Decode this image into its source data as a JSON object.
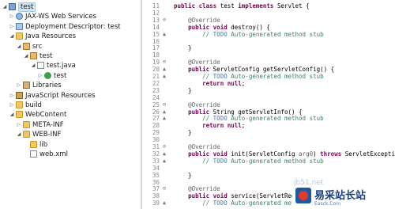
{
  "explorer": {
    "items": [
      {
        "label": "test",
        "icon": "project-icon",
        "twisty": "open",
        "indent": 0,
        "selected": true
      },
      {
        "label": "JAX-WS Web Services",
        "icon": "web-services-icon",
        "twisty": "closed",
        "indent": 1
      },
      {
        "label": "Deployment Descriptor: test",
        "icon": "deployment-descriptor-icon",
        "twisty": "closed",
        "indent": 1
      },
      {
        "label": "Java Resources",
        "icon": "java-resources-icon",
        "twisty": "open",
        "indent": 1
      },
      {
        "label": "src",
        "icon": "source-folder-icon",
        "twisty": "open",
        "indent": 2
      },
      {
        "label": "test",
        "icon": "package-icon",
        "twisty": "open",
        "indent": 3
      },
      {
        "label": "test.java",
        "icon": "java-file-icon",
        "twisty": "open",
        "indent": 4
      },
      {
        "label": "test",
        "icon": "class-icon",
        "twisty": "closed",
        "indent": 5
      },
      {
        "label": "Libraries",
        "icon": "libraries-icon",
        "twisty": "closed",
        "indent": 2
      },
      {
        "label": "JavaScript Resources",
        "icon": "javascript-resources-icon",
        "twisty": "closed",
        "indent": 1
      },
      {
        "label": "build",
        "icon": "folder-icon",
        "twisty": "closed",
        "indent": 1
      },
      {
        "label": "WebContent",
        "icon": "folder-icon",
        "twisty": "open",
        "indent": 1
      },
      {
        "label": "META-INF",
        "icon": "folder-icon",
        "twisty": "closed",
        "indent": 2
      },
      {
        "label": "WEB-INF",
        "icon": "folder-icon",
        "twisty": "open",
        "indent": 2
      },
      {
        "label": "lib",
        "icon": "folder-icon",
        "twisty": "none",
        "indent": 3
      },
      {
        "label": "web.xml",
        "icon": "xml-file-icon",
        "twisty": "none",
        "indent": 3
      }
    ]
  },
  "editor": {
    "lines": [
      {
        "num": "11",
        "marker": "",
        "tokens": [
          {
            "t": "public class ",
            "c": "kw"
          },
          {
            "t": "test "
          },
          {
            "t": "implements ",
            "c": "kw"
          },
          {
            "t": "Servlet {"
          }
        ]
      },
      {
        "num": "12",
        "marker": "",
        "tokens": []
      },
      {
        "num": "13",
        "marker": "⊖",
        "tokens": [
          {
            "t": "    "
          },
          {
            "t": "@Override",
            "c": "ann"
          }
        ]
      },
      {
        "num": "14",
        "marker": "",
        "tokens": [
          {
            "t": "    "
          },
          {
            "t": "public void ",
            "c": "kw"
          },
          {
            "t": "destroy() {"
          }
        ]
      },
      {
        "num": "15",
        "marker": "▲",
        "tokens": [
          {
            "t": "        "
          },
          {
            "t": "// ",
            "c": "cm"
          },
          {
            "t": "TODO",
            "c": "todo"
          },
          {
            "t": " Auto-generated method stub",
            "c": "cm"
          }
        ]
      },
      {
        "num": "16",
        "marker": "",
        "tokens": []
      },
      {
        "num": "17",
        "marker": "",
        "tokens": [
          {
            "t": "    }"
          }
        ]
      },
      {
        "num": "18",
        "marker": "",
        "tokens": []
      },
      {
        "num": "19",
        "marker": "⊖",
        "tokens": [
          {
            "t": "    "
          },
          {
            "t": "@Override",
            "c": "ann"
          }
        ]
      },
      {
        "num": "20",
        "marker": "▲",
        "tokens": [
          {
            "t": "    "
          },
          {
            "t": "public ",
            "c": "kw"
          },
          {
            "t": "ServletConfig getServletConfig() {"
          }
        ]
      },
      {
        "num": "21",
        "marker": "▲",
        "tokens": [
          {
            "t": "        "
          },
          {
            "t": "// ",
            "c": "cm"
          },
          {
            "t": "TODO",
            "c": "todo"
          },
          {
            "t": " Auto-generated method stub",
            "c": "cm"
          }
        ]
      },
      {
        "num": "22",
        "marker": "",
        "tokens": [
          {
            "t": "        "
          },
          {
            "t": "return null",
            "c": "kw"
          },
          {
            "t": ";"
          }
        ]
      },
      {
        "num": "23",
        "marker": "",
        "tokens": [
          {
            "t": "    }"
          }
        ]
      },
      {
        "num": "24",
        "marker": "",
        "tokens": []
      },
      {
        "num": "25",
        "marker": "⊖",
        "tokens": [
          {
            "t": "    "
          },
          {
            "t": "@Override",
            "c": "ann"
          }
        ]
      },
      {
        "num": "26",
        "marker": "▲",
        "tokens": [
          {
            "t": "    "
          },
          {
            "t": "public ",
            "c": "kw"
          },
          {
            "t": "String getServletInfo() {"
          }
        ]
      },
      {
        "num": "27",
        "marker": "▲",
        "tokens": [
          {
            "t": "        "
          },
          {
            "t": "// ",
            "c": "cm"
          },
          {
            "t": "TODO",
            "c": "todo"
          },
          {
            "t": " Auto-generated method stub",
            "c": "cm"
          }
        ]
      },
      {
        "num": "28",
        "marker": "",
        "tokens": [
          {
            "t": "        "
          },
          {
            "t": "return null",
            "c": "kw"
          },
          {
            "t": ";"
          }
        ]
      },
      {
        "num": "29",
        "marker": "",
        "tokens": [
          {
            "t": "    }"
          }
        ]
      },
      {
        "num": "30",
        "marker": "",
        "tokens": []
      },
      {
        "num": "31",
        "marker": "⊖",
        "tokens": [
          {
            "t": "    "
          },
          {
            "t": "@Override",
            "c": "ann"
          }
        ]
      },
      {
        "num": "32",
        "marker": "▲",
        "tokens": [
          {
            "t": "    "
          },
          {
            "t": "public void ",
            "c": "kw"
          },
          {
            "t": "init(ServletConfig "
          },
          {
            "t": "arg0",
            "c": "ann"
          },
          {
            "t": ") "
          },
          {
            "t": "throws ",
            "c": "kw"
          },
          {
            "t": "ServletException {"
          }
        ]
      },
      {
        "num": "33",
        "marker": "▲",
        "tokens": [
          {
            "t": "        "
          },
          {
            "t": "// ",
            "c": "cm"
          },
          {
            "t": "TODO",
            "c": "todo"
          },
          {
            "t": " Auto-generated method stub",
            "c": "cm"
          }
        ]
      },
      {
        "num": "34",
        "marker": "",
        "tokens": []
      },
      {
        "num": "35",
        "marker": "",
        "tokens": [
          {
            "t": "    }"
          }
        ]
      },
      {
        "num": "36",
        "marker": "",
        "tokens": []
      },
      {
        "num": "37",
        "marker": "⊖",
        "tokens": [
          {
            "t": "    "
          },
          {
            "t": "@Override",
            "c": "ann"
          }
        ]
      },
      {
        "num": "38",
        "marker": "",
        "tokens": [
          {
            "t": "    "
          },
          {
            "t": "public void ",
            "c": "kw"
          },
          {
            "t": "service(ServletReque"
          }
        ]
      },
      {
        "num": "39",
        "marker": "▲",
        "tokens": [
          {
            "t": "        "
          },
          {
            "t": "// ",
            "c": "cm"
          },
          {
            "t": "TODO",
            "c": "todo"
          },
          {
            "t": " Auto-generated meth",
            "c": "cm"
          }
        ]
      }
    ]
  },
  "watermark": {
    "url": "jb51.net",
    "title": "易采站长站",
    "subtitle": "Easck.Com",
    "logo_color": "#1c5aa6",
    "accent_color": "#e23b2b"
  }
}
